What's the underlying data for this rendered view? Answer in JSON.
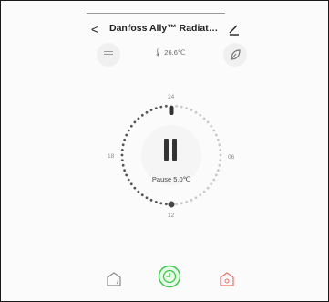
{
  "header": {
    "back_label": "<",
    "title": "Danfoss Ally™ Radiator The...",
    "edit_icon": "edit-pencil-icon"
  },
  "status": {
    "current_temperature": "26.6℃",
    "temp_prefix_icon": "thermometer-icon"
  },
  "dial": {
    "mode_label": "Pause 5.0℃",
    "ticks": {
      "top": "24",
      "left": "18",
      "right": "06",
      "bottom": "12"
    }
  },
  "icons": {
    "menu": "hamburger-menu-icon",
    "leaf": "leaf-icon",
    "home_away": "house-away-icon",
    "schedule": "schedule-clock-icon",
    "home_alert": "house-alert-icon"
  },
  "colors": {
    "accent": "#2ecc40",
    "alert": "#f06d6d",
    "dial_active": "#555555",
    "dial_inactive": "#c9c9c9"
  }
}
